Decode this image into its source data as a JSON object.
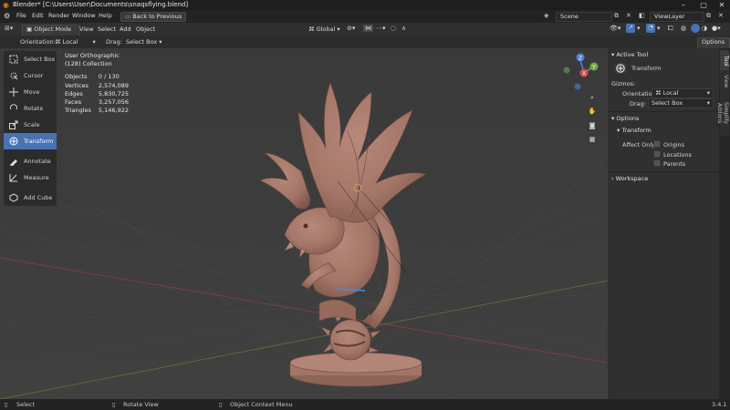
{
  "window": {
    "title": "Blender* [C:\\Users\\User\\Documents\\snaqsflying.blend]"
  },
  "menu": {
    "items": [
      "File",
      "Edit",
      "Render",
      "Window",
      "Help"
    ],
    "back_label": "Back to Previous",
    "scene": "Scene",
    "view_layer": "ViewLayer"
  },
  "header": {
    "mode": "Object Mode",
    "menu": [
      "View",
      "Select",
      "Add",
      "Object"
    ],
    "orientation": "Global"
  },
  "tool_settings": {
    "orientation_label": "Orientation:",
    "orientation_value": "Local",
    "drag_label": "Drag:",
    "drag_value": "Select Box",
    "options_label": "Options"
  },
  "toolbar": {
    "items": [
      "Select Box",
      "Cursor",
      "Move",
      "Rotate",
      "Scale",
      "Transform",
      "Annotate",
      "Measure",
      "Add Cube"
    ],
    "selected": "Transform"
  },
  "stats": {
    "view": "User Orthographic",
    "collection": "(128) Collection",
    "rows": [
      [
        "Objects",
        "0 / 130"
      ],
      [
        "Vertices",
        "2,574,089"
      ],
      [
        "Edges",
        "5,830,725"
      ],
      [
        "Faces",
        "3,257,056"
      ],
      [
        "Triangles",
        "5,146,922"
      ]
    ]
  },
  "gizmo": {
    "z": "Z",
    "y": "Y",
    "x": "X"
  },
  "npanel": {
    "active_tool_header": "Active Tool",
    "tool_name": "Transform",
    "gizmos_label": "Gizmos:",
    "orientation_label": "Orientation",
    "orientation_value": "Local",
    "drag_label": "Drag:",
    "drag_value": "Select Box",
    "options_header": "Options",
    "transform_header": "Transform",
    "affect_only": "Affect Only",
    "checks": [
      "Origins",
      "Locations",
      "Parents"
    ],
    "workspace_header": "Workspace",
    "tabs": [
      "Tool",
      "View",
      "Simplify Addons"
    ]
  },
  "statusbar": {
    "select": "Select",
    "rotate": "Rotate View",
    "context": "Object Context Menu",
    "version": "3.4.1"
  },
  "colors": {
    "accent": "#4772b3",
    "model": "#a77a6d",
    "background": "#3d3d3d"
  }
}
